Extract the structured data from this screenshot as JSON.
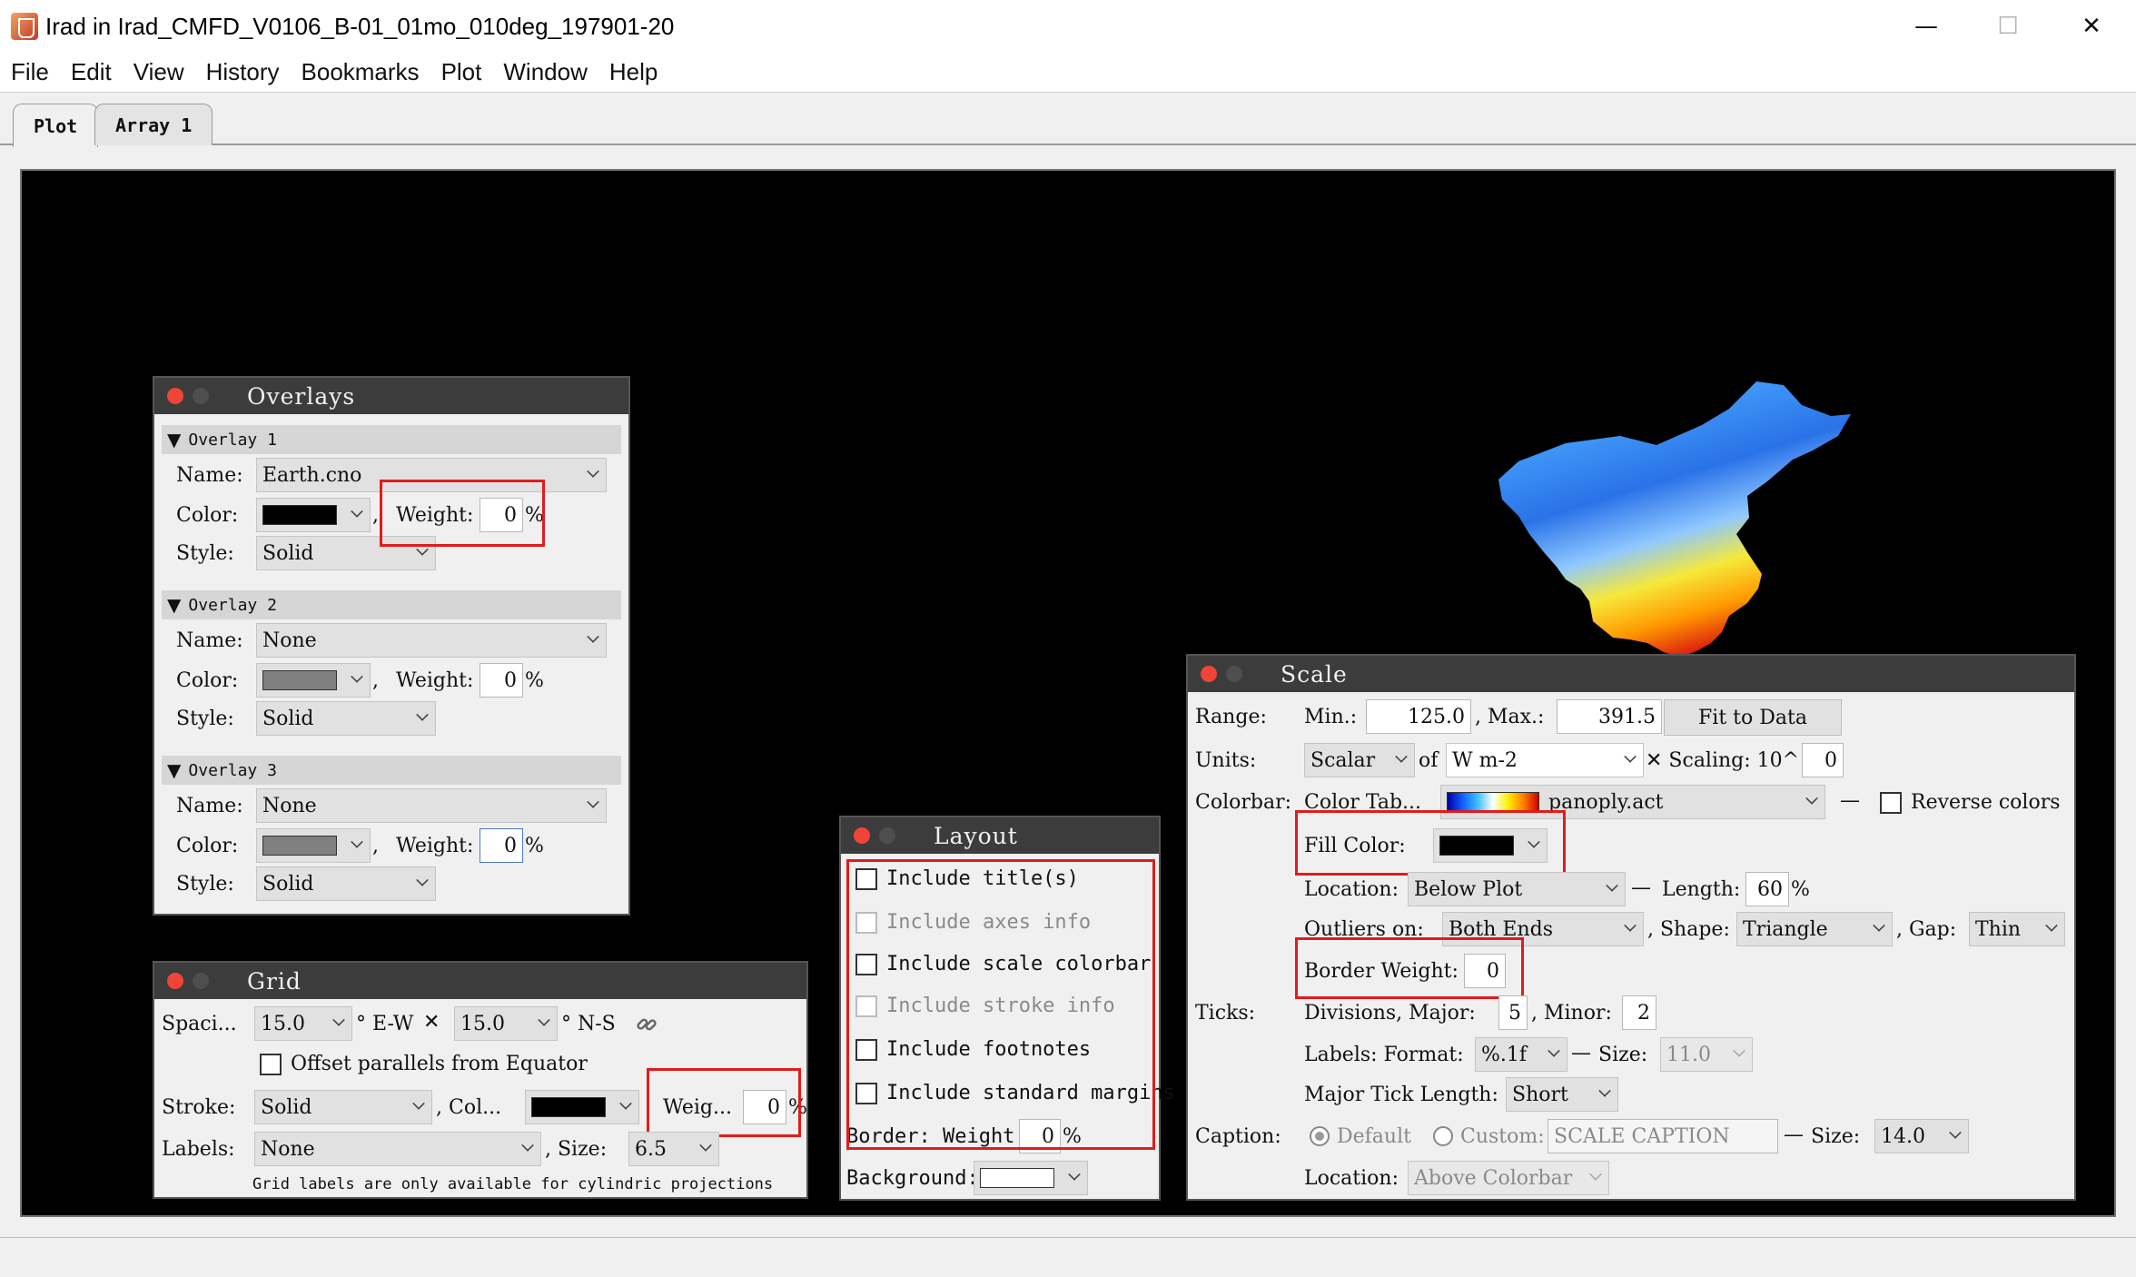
{
  "window": {
    "title": "Irad in Irad_CMFD_V0106_B-01_01mo_010deg_197901-20",
    "minimize": "—",
    "maximize": "☐",
    "close": "✕"
  },
  "menu": [
    "File",
    "Edit",
    "View",
    "History",
    "Bookmarks",
    "Plot",
    "Window",
    "Help"
  ],
  "tabs": [
    {
      "label": "Plot",
      "active": true
    },
    {
      "label": "Array 1",
      "active": false
    }
  ],
  "overlays": {
    "title": "Overlays",
    "labels": {
      "name": "Name:",
      "color": "Color:",
      "weight": "Weight:",
      "style": "Style:",
      "pct": "%"
    },
    "items": [
      {
        "header": "Overlay 1",
        "name": "Earth.cno",
        "color": "#000000",
        "weight": "0",
        "style": "Solid"
      },
      {
        "header": "Overlay 2",
        "name": "None",
        "color": "#808080",
        "weight": "0",
        "style": "Solid"
      },
      {
        "header": "Overlay 3",
        "name": "None",
        "color": "#808080",
        "weight": "0",
        "style": "Solid"
      }
    ]
  },
  "grid": {
    "title": "Grid",
    "spacing_label": "Spaci...",
    "ew_value": "15.0",
    "ew_label": "° E-W",
    "times": "✕",
    "ns_value": "15.0",
    "ns_label": "° N-S",
    "offset_label": "Offset parallels from Equator",
    "stroke_label": "Stroke:",
    "stroke_value": "Solid",
    "color_label": ", Col...",
    "color": "#000000",
    "weight_label": "Weig...",
    "weight_value": "0",
    "pct": "%",
    "labels_label": "Labels:",
    "labels_value": "None",
    "size_label": ", Size:",
    "size_value": "6.5",
    "note": "Grid labels are only available for cylindric projections"
  },
  "layout": {
    "title": "Layout",
    "options": [
      {
        "label": "Include title(s)",
        "enabled": true
      },
      {
        "label": "Include axes info",
        "enabled": false
      },
      {
        "label": "Include scale colorbar",
        "enabled": true
      },
      {
        "label": "Include stroke info",
        "enabled": false
      },
      {
        "label": "Include footnotes",
        "enabled": true
      },
      {
        "label": "Include standard margins",
        "enabled": true
      }
    ],
    "border_label": "Border: Weight:",
    "border_value": "0",
    "pct": "%",
    "background_label": "Background:",
    "background_color": "#ffffff"
  },
  "scale": {
    "title": "Scale",
    "range_label": "Range:",
    "min_label": "Min.:",
    "min_value": "125.0",
    "max_label": ", Max.:",
    "max_value": "391.5",
    "fit_button": "Fit to Data",
    "units_label": "Units:",
    "units_type": "Scalar",
    "of_label": "of",
    "units_value": "W m-2",
    "scaling_label": "✕ Scaling: 10^",
    "scaling_value": "0",
    "colorbar_label": "Colorbar:",
    "colortab_label": "Color Tab...",
    "colortab_value": "panoply.act",
    "dash": "—",
    "reverse_label": "Reverse colors",
    "fill_label": "Fill Color:",
    "fill_color": "#000000",
    "location_label": "Location:",
    "location_value": "Below Plot",
    "length_label": "Length:",
    "length_value": "60",
    "pct": "%",
    "outliers_label": "Outliers on:",
    "outliers_value": "Both Ends",
    "shape_label": ", Shape:",
    "shape_value": "Triangle",
    "gap_label": ", Gap:",
    "gap_value": "Thin",
    "border_weight_label": "Border Weight:",
    "border_weight_value": "0",
    "ticks_label": "Ticks:",
    "divisions_label": "Divisions, Major:",
    "major_value": "5",
    "minor_label": ", Minor:",
    "minor_value": "2",
    "format_label": "Labels: Format:",
    "format_value": "%.1f",
    "tick_size_label": "Size:",
    "tick_size_value": "11.0",
    "tick_length_label": "Major Tick Length:",
    "tick_length_value": "Short",
    "caption_label": "Caption:",
    "default_label": "Default",
    "custom_label": "Custom:",
    "caption_placeholder": "SCALE CAPTION",
    "caption_size_label": "Size:",
    "caption_size_value": "14.0",
    "caption_location_label": "Location:",
    "caption_location_value": "Above Colorbar"
  }
}
